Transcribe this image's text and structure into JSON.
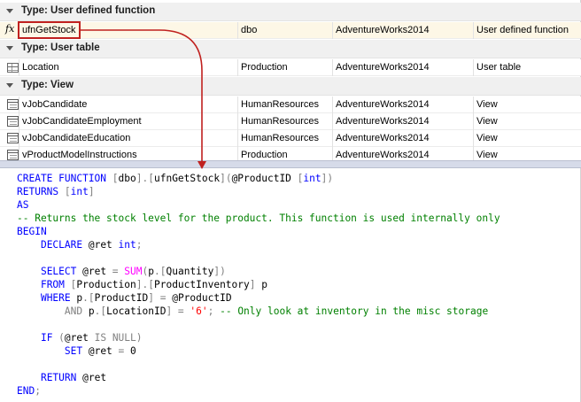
{
  "groups": [
    {
      "title": "Type: User defined function",
      "rows": [
        {
          "icon": "function-icon",
          "name": "ufnGetStock",
          "schema": "dbo",
          "database": "AdventureWorks2014",
          "type": "User defined function",
          "selected": true
        }
      ]
    },
    {
      "title": "Type: User table",
      "rows": [
        {
          "icon": "table-icon",
          "name": "Location",
          "schema": "Production",
          "database": "AdventureWorks2014",
          "type": "User table"
        }
      ]
    },
    {
      "title": "Type: View",
      "rows": [
        {
          "icon": "view-icon",
          "name": "vJobCandidate",
          "schema": "HumanResources",
          "database": "AdventureWorks2014",
          "type": "View"
        },
        {
          "icon": "view-icon",
          "name": "vJobCandidateEmployment",
          "schema": "HumanResources",
          "database": "AdventureWorks2014",
          "type": "View"
        },
        {
          "icon": "view-icon",
          "name": "vJobCandidateEducation",
          "schema": "HumanResources",
          "database": "AdventureWorks2014",
          "type": "View"
        },
        {
          "icon": "view-icon",
          "name": "vProductModelInstructions",
          "schema": "Production",
          "database": "AdventureWorks2014",
          "type": "View"
        }
      ]
    }
  ],
  "fx_glyph": "fx",
  "code_lines": [
    [
      [
        "kw",
        "CREATE FUNCTION "
      ],
      [
        "gr",
        "["
      ],
      [
        "pl",
        "dbo"
      ],
      [
        "gr",
        "]."
      ],
      [
        "gr",
        "["
      ],
      [
        "pl",
        "ufnGetStock"
      ],
      [
        "gr",
        "]("
      ],
      [
        "pl",
        "@ProductID "
      ],
      [
        "gr",
        "["
      ],
      [
        "kw",
        "int"
      ],
      [
        "gr",
        "])"
      ]
    ],
    [
      [
        "kw",
        "RETURNS "
      ],
      [
        "gr",
        "["
      ],
      [
        "kw",
        "int"
      ],
      [
        "gr",
        "]"
      ]
    ],
    [
      [
        "kw",
        "AS"
      ]
    ],
    [
      [
        "cm",
        "-- Returns the stock level for the product. This function is used internally only"
      ]
    ],
    [
      [
        "kw",
        "BEGIN"
      ]
    ],
    [
      [
        "pl",
        "    "
      ],
      [
        "kw",
        "DECLARE "
      ],
      [
        "pl",
        "@ret "
      ],
      [
        "kw",
        "int"
      ],
      [
        "gr",
        ";"
      ]
    ],
    [],
    [
      [
        "pl",
        "    "
      ],
      [
        "kw",
        "SELECT "
      ],
      [
        "pl",
        "@ret "
      ],
      [
        "gr",
        "= "
      ],
      [
        "fn",
        "SUM"
      ],
      [
        "gr",
        "("
      ],
      [
        "pl",
        "p"
      ],
      [
        "gr",
        "."
      ],
      [
        "gr",
        "["
      ],
      [
        "pl",
        "Quantity"
      ],
      [
        "gr",
        "])"
      ]
    ],
    [
      [
        "pl",
        "    "
      ],
      [
        "kw",
        "FROM "
      ],
      [
        "gr",
        "["
      ],
      [
        "pl",
        "Production"
      ],
      [
        "gr",
        "]."
      ],
      [
        "gr",
        "["
      ],
      [
        "pl",
        "ProductInventory"
      ],
      [
        "gr",
        "] "
      ],
      [
        "pl",
        "p"
      ]
    ],
    [
      [
        "pl",
        "    "
      ],
      [
        "kw",
        "WHERE "
      ],
      [
        "pl",
        "p"
      ],
      [
        "gr",
        "."
      ],
      [
        "gr",
        "["
      ],
      [
        "pl",
        "ProductID"
      ],
      [
        "gr",
        "] = "
      ],
      [
        "pl",
        "@ProductID"
      ]
    ],
    [
      [
        "pl",
        "        "
      ],
      [
        "gr",
        "AND "
      ],
      [
        "pl",
        "p"
      ],
      [
        "gr",
        "."
      ],
      [
        "gr",
        "["
      ],
      [
        "pl",
        "LocationID"
      ],
      [
        "gr",
        "] = "
      ],
      [
        "st",
        "'6'"
      ],
      [
        "gr",
        "; "
      ],
      [
        "cm",
        "-- Only look at inventory in the misc storage"
      ]
    ],
    [],
    [
      [
        "pl",
        "    "
      ],
      [
        "kw",
        "IF "
      ],
      [
        "gr",
        "("
      ],
      [
        "pl",
        "@ret "
      ],
      [
        "gr",
        "IS NULL"
      ],
      [
        "gr",
        ")"
      ]
    ],
    [
      [
        "pl",
        "        "
      ],
      [
        "kw",
        "SET "
      ],
      [
        "pl",
        "@ret "
      ],
      [
        "gr",
        "= "
      ],
      [
        "pl",
        "0"
      ]
    ],
    [],
    [
      [
        "pl",
        "    "
      ],
      [
        "kw",
        "RETURN "
      ],
      [
        "pl",
        "@ret"
      ]
    ],
    [
      [
        "kw",
        "END"
      ],
      [
        "gr",
        ";"
      ]
    ]
  ],
  "colors": {
    "keyword": "#0000ff",
    "comment": "#008000",
    "operator": "#808080",
    "function": "#ff00ff",
    "string": "#ff0000",
    "highlight": "#c0211f",
    "splitter": "#d6dbe9"
  }
}
